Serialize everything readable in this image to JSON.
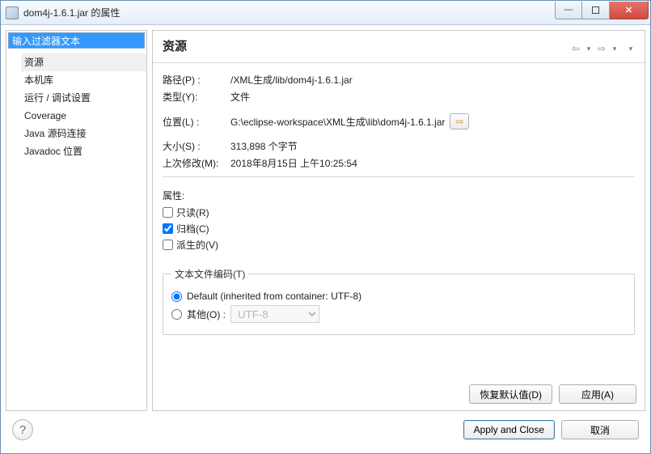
{
  "window": {
    "title": "dom4j-1.6.1.jar 的属性"
  },
  "nav": {
    "filter_placeholder": "输入过滤器文本",
    "filter_value": "输入过滤器文本",
    "items": [
      "资源",
      "本机库",
      "运行 / 调试设置",
      "Coverage",
      "Java 源码连接",
      "Javadoc 位置"
    ],
    "selected_index": 0
  },
  "header": {
    "title": "资源"
  },
  "kv": {
    "path_label": "路径(P) :",
    "path_value": "/XML生成/lib/dom4j-1.6.1.jar",
    "type_label": "类型(Y):",
    "type_value": "文件",
    "location_label": "位置(L) :",
    "location_value": "G:\\eclipse-workspace\\XML生成\\lib\\dom4j-1.6.1.jar",
    "size_label": "大小(S) :",
    "size_value": "313,898 个字节",
    "modified_label": "上次修改(M):",
    "modified_value": "2018年8月15日 上午10:25:54"
  },
  "attrs": {
    "heading": "属性:",
    "readonly_label": "只读(R)",
    "readonly_checked": false,
    "archive_label": "归档(C)",
    "archive_checked": true,
    "derived_label": "派生的(V)",
    "derived_checked": false
  },
  "encoding": {
    "legend": "文本文件编码(T)",
    "default_label": "Default (inherited from container: UTF-8)",
    "other_label": "其他(O) :",
    "selected": "default",
    "other_value": "UTF-8"
  },
  "buttons": {
    "restore_defaults": "恢复默认值(D)",
    "apply": "应用(A)",
    "apply_and_close": "Apply and Close",
    "cancel": "取消"
  },
  "icons": {
    "show_in_explorer": "⇨",
    "help": "?"
  }
}
